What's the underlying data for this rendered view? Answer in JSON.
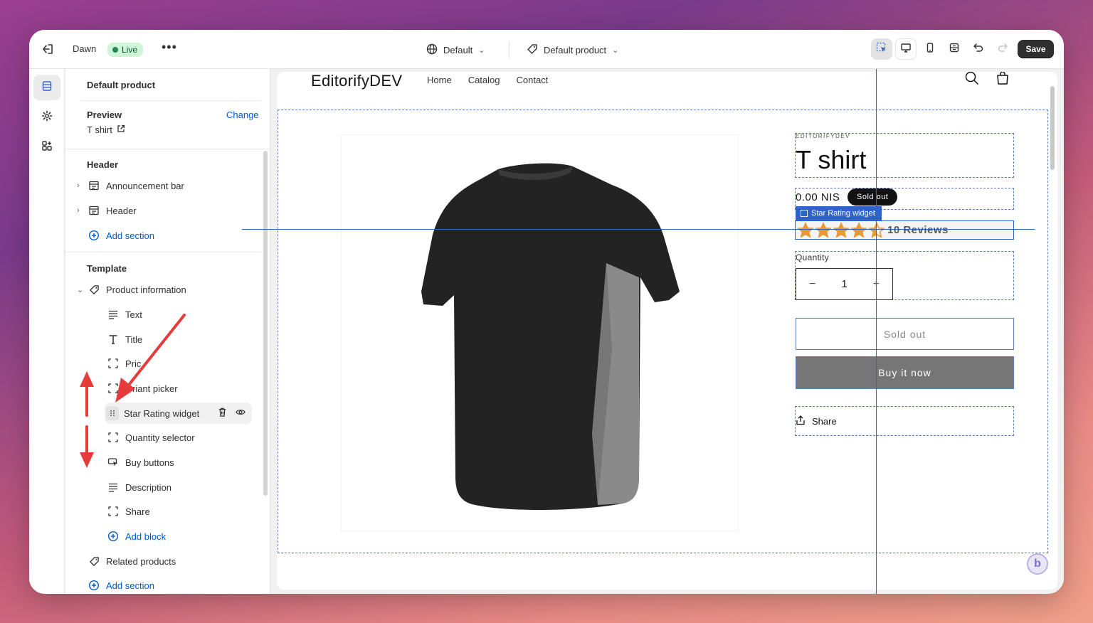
{
  "topbar": {
    "store_name": "Dawn",
    "status": "Live",
    "more": "•••",
    "theme_selector": "Default",
    "template_selector": "Default product",
    "save_label": "Save"
  },
  "sidebar": {
    "title": "Default product",
    "preview_label": "Preview",
    "change_label": "Change",
    "preview_value": "T shirt",
    "header_group": "Header",
    "header_items": [
      {
        "label": "Announcement bar",
        "icon": "layout-section-icon"
      },
      {
        "label": "Header",
        "icon": "layout-section-icon"
      }
    ],
    "add_section": "Add section",
    "template_group": "Template",
    "product_info": "Product information",
    "blocks": [
      {
        "label": "Text",
        "icon": "text-lines-icon"
      },
      {
        "label": "Title",
        "icon": "text-title-icon"
      },
      {
        "label": "Pric",
        "icon": "block-frame-icon"
      },
      {
        "label": "riant picker",
        "icon": "block-frame-icon"
      },
      {
        "label": "Star Rating widget",
        "icon": "drag-handle-icon"
      },
      {
        "label": "Quantity selector",
        "icon": "block-frame-icon"
      },
      {
        "label": "Buy buttons",
        "icon": "cursor-click-icon"
      },
      {
        "label": "Description",
        "icon": "text-lines-icon"
      },
      {
        "label": "Share",
        "icon": "block-frame-icon"
      }
    ],
    "add_block": "Add block",
    "related_products": "Related products",
    "add_section_2": "Add section"
  },
  "store": {
    "name": "EditorifyDEV",
    "nav": [
      "Home",
      "Catalog",
      "Contact"
    ],
    "vendor": "EDITORIFYDEV",
    "product_title": "T shirt",
    "price": "0.00 NIS",
    "badge": "Sold out",
    "widget_tag": "Star Rating widget",
    "rating": 4.5,
    "reviews": "10 Reviews",
    "quantity_label": "Quantity",
    "quantity_value": "1",
    "minus": "−",
    "plus": "+",
    "sold_out_button": "Sold out",
    "buy_now_button": "Buy it now",
    "share_label": "Share"
  },
  "colors": {
    "accent_blue": "#2f63c9",
    "link_blue": "#005bd3",
    "star_orange": "#e8992f",
    "annotation_red": "#e63b3b",
    "live_green": "#29845a"
  }
}
